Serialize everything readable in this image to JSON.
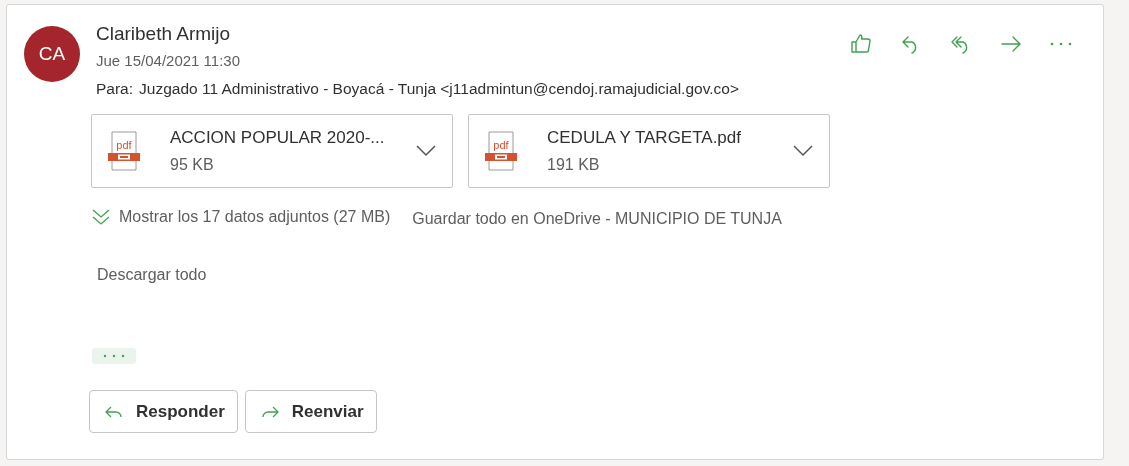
{
  "message": {
    "avatar_initials": "CA",
    "sender": "Claribeth Armijo",
    "date": "Jue 15/04/2021 11:30",
    "to_label": "Para:",
    "to": "Juzgado 11 Administrativo - Boyacá - Tunja <j11admintun@cendoj.ramajudicial.gov.co>"
  },
  "attachments": [
    {
      "icon_label": "pdf",
      "name": "ACCION POPULAR 2020-...",
      "size": "95 KB"
    },
    {
      "icon_label": "pdf",
      "name": "CEDULA Y TARGETA.pdf",
      "size": "191 KB"
    }
  ],
  "show_all": "Mostrar los 17 datos adjuntos (27 MB)",
  "save_all": "Guardar todo en OneDrive - MUNICIPIO DE TUNJA",
  "download_all": "Descargar todo",
  "buttons": [
    {
      "kind": "reply",
      "label": "Responder"
    },
    {
      "kind": "forward",
      "label": "Reenviar"
    }
  ]
}
